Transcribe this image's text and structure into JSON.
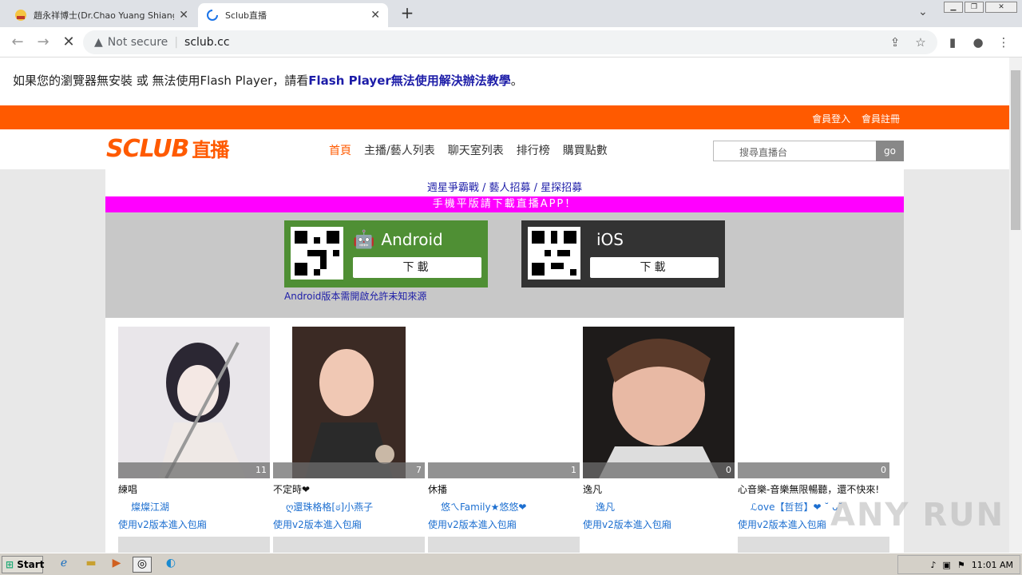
{
  "browser": {
    "tabs": [
      {
        "title": "趙永祥博士(Dr.Chao Yuang Shiang)",
        "close": "✕"
      },
      {
        "title": "Sclub直播",
        "close": "✕"
      }
    ],
    "new_tab": "+",
    "address": {
      "security": "Not secure",
      "url": "sclub.cc"
    }
  },
  "page": {
    "flash_notice": {
      "prefix": "如果您的瀏覽器無安裝 或 無法使用Flash Player，請看",
      "link": "Flash Player無法使用解決辦法教學",
      "suffix": "。"
    },
    "topbar": {
      "login": "會員登入",
      "register": "會員註冊"
    },
    "logo": {
      "brand": "SCLUB",
      "suffix": "直播"
    },
    "nav": [
      "首頁",
      "主播/藝人列表",
      "聊天室列表",
      "排行榜",
      "購買點數"
    ],
    "search": {
      "placeholder": "搜尋直播台",
      "button": "go"
    },
    "recruit_text": "週星爭霸戰 / 藝人招募 / 星探招募",
    "app_banner": "手機平版請下載直播APP！",
    "apps": {
      "android": {
        "name": "Android",
        "download": "下載"
      },
      "ios": {
        "name": "iOS",
        "download": "下載"
      },
      "android_note": "Android版本需開啟允許未知來源"
    },
    "cards": [
      {
        "count": "11",
        "title": "練唱",
        "user": "燦燦江湖",
        "v2": "使用v2版本進入包廂"
      },
      {
        "count": "7",
        "title": "不定時❤",
        "user": "ღ還珠格格[ಠ]小燕子",
        "v2": "使用v2版本進入包廂"
      },
      {
        "count": "1",
        "title": "休播",
        "user": "悠ㄟFamily★悠悠❤",
        "v2": "使用v2版本進入包廂"
      },
      {
        "count": "0",
        "title": "逸凡",
        "user": "逸凡",
        "v2": "使用v2版本進入包廂"
      },
      {
        "count": "0",
        "title": "心音樂-音樂無限暢聽，還不快來!",
        "user": "ℒove【哲哲】❤ ˘ ᴗ˘",
        "v2": "使用v2版本進入包廂"
      }
    ],
    "watermark": "ANY RUN"
  },
  "taskbar": {
    "start": "Start",
    "time": "11:01 AM"
  }
}
